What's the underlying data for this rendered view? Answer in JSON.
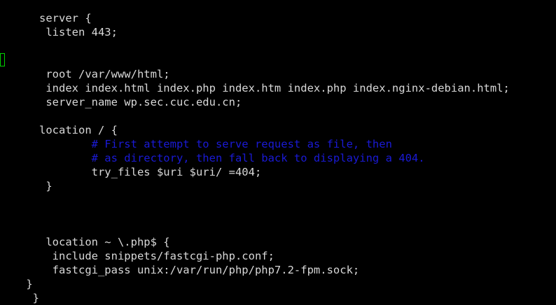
{
  "editor": {
    "lines": [
      "      server {",
      "       listen 443;",
      "",
      "",
      "       root /var/www/html;",
      "       index index.html index.php index.htm index.php index.nginx-debian.html;",
      "       server_name wp.sec.cuc.edu.cn;",
      "",
      "      location / {",
      "              # First attempt to serve request as file, then",
      "              # as directory, then fall back to displaying a 404.",
      "              try_files $uri $uri/ =404;",
      "       }",
      "",
      "",
      "",
      "       location ~ \\.php$ {",
      "        include snippets/fastcgi-php.conf;",
      "        fastcgi_pass unix:/var/run/php/php7.2-fpm.sock;",
      "    }",
      "     }"
    ],
    "comment_lines": [
      9,
      10
    ],
    "cursor_line": 3,
    "colors": {
      "background": "#000000",
      "text": "#d8d8d8",
      "comment": "#1a1ad6",
      "cursor": "#00d000"
    }
  }
}
